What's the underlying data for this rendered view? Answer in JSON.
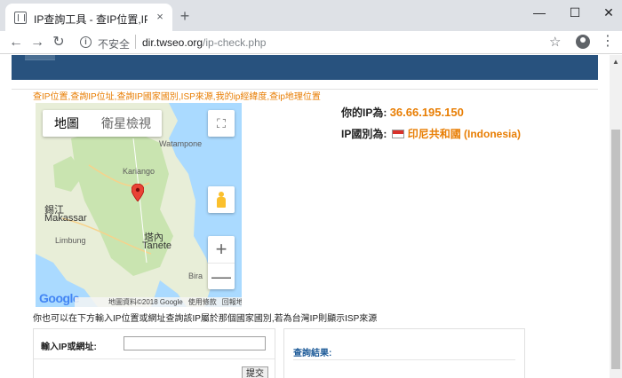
{
  "browser": {
    "tab_title": "IP查詢工具 - 查IP位置,IP查國家",
    "tab_close": "×",
    "new_tab": "+",
    "window": {
      "minimize": "—",
      "maximize": "☐",
      "close": "✕"
    },
    "nav": {
      "back": "←",
      "forward": "→",
      "reload": "↻"
    },
    "security_text": "不安全",
    "url_host": "dir.twseo.org",
    "url_path": "/ip-check.php",
    "star": "☆",
    "menu": "⋮"
  },
  "page": {
    "keywords": "查IP位置,查詢IP位址,查詢IP國家國別,ISP來源,我的ip經緯度,查ip地理位置",
    "ip_label": "你的IP為:",
    "ip_value": "36.66.195.150",
    "country_label": "IP國別為:",
    "country_value": "印尼共和國 (Indonesia)",
    "flag_colors": {
      "top": "#d9312b",
      "bottom": "#ffffff"
    },
    "hint": "你也可以在下方輸入IP位置或網址查詢該IP屬於那個國家國別,若為台灣IP則顯示ISP來源",
    "form": {
      "label": "輸入IP或網址:",
      "value": "",
      "submit": "提交"
    },
    "result_label": "查詢結果:"
  },
  "map": {
    "type_map": "地圖",
    "type_satellite": "衛星檢視",
    "fullscreen": "⛶",
    "zoom_in": "+",
    "zoom_out": "—",
    "labels": {
      "watampone": "Watampone",
      "kariango": "Kariango",
      "city_zh": "錫江",
      "makassar": "Makassar",
      "limbung": "Limbung",
      "tanete_zh": "塔內",
      "tanete": "Tanete",
      "bira": "Bira"
    },
    "logo": "Google",
    "data_credit": "地圖資料©2018 Google",
    "terms": "使用條款",
    "report": "回報地圖錯誤",
    "colors": {
      "water": "#aadaff",
      "land": "#e8eed8",
      "park": "#c9e4b0",
      "pin": "#e94335"
    }
  }
}
